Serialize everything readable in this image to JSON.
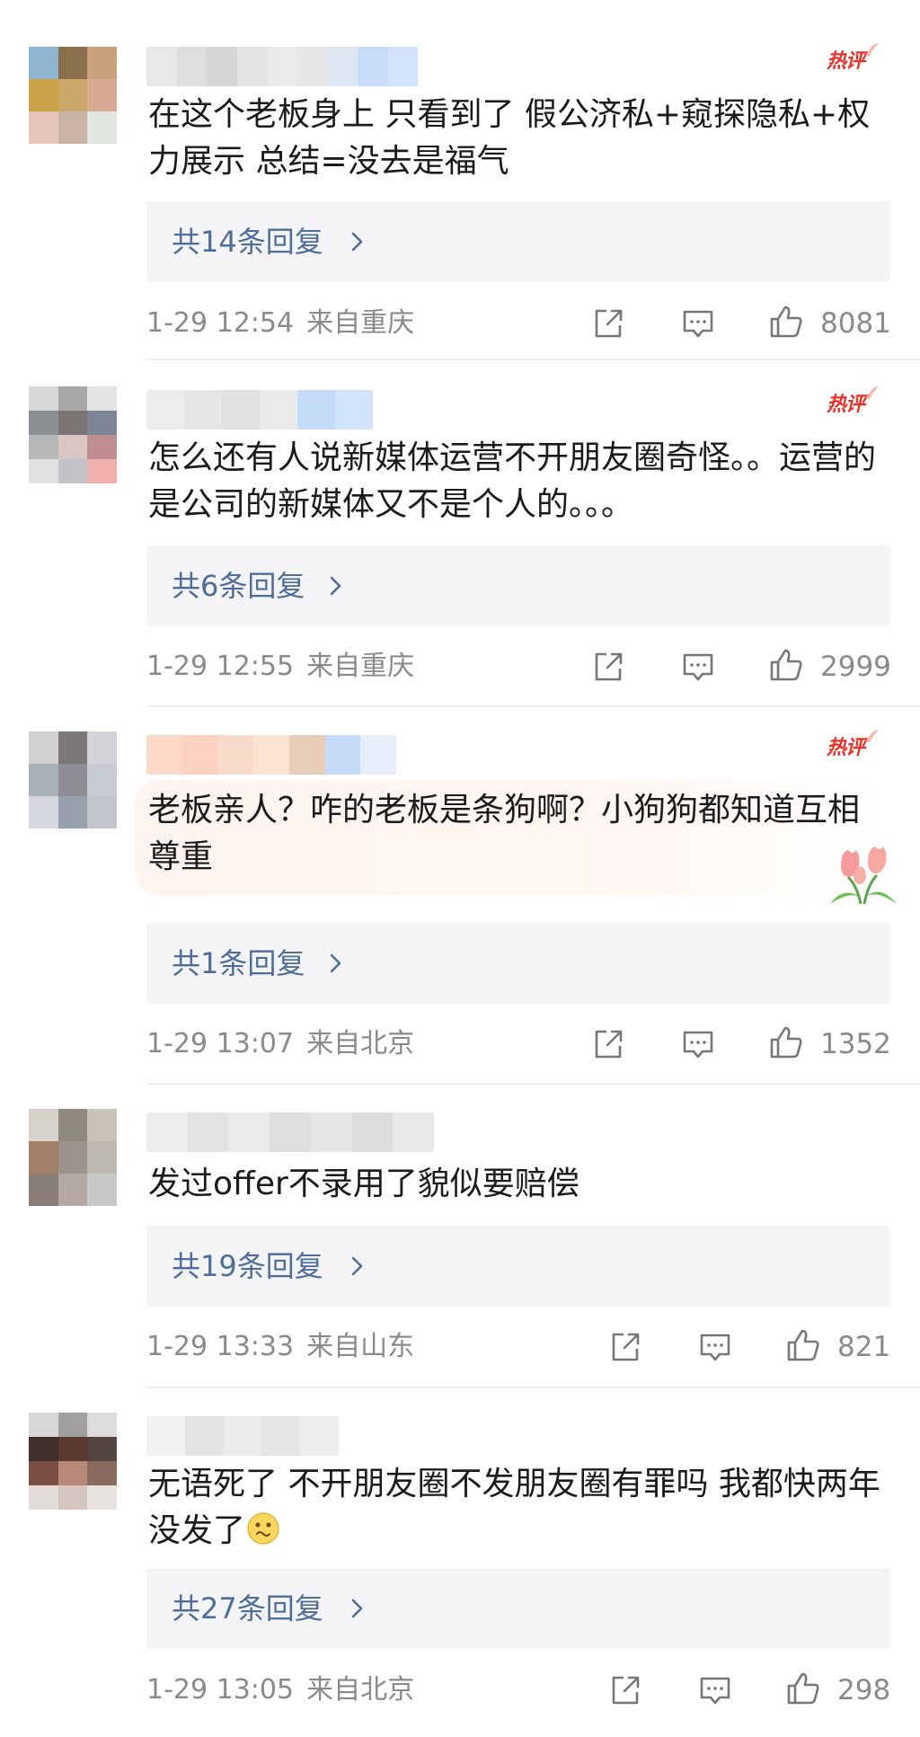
{
  "hot_badge_label": "热评",
  "colors": {
    "accent_link": "#4d6d9a",
    "hot_red": "#e6332a",
    "meta_gray": "#8a8a8a",
    "reply_bg": "#f4f4f6"
  },
  "icons": {
    "share": "share-icon",
    "comment": "comment-icon",
    "like": "thumbs-up-icon",
    "chevron": "chevron-right-icon"
  },
  "comments": [
    {
      "hot": true,
      "text": "在这个老板身上 只看到了 假公济私+窥探隐私+权力展示 总结=没去是福气",
      "reply_label": "共14条回复",
      "time": "1-29 12:54",
      "location": "来自重庆",
      "likes": "8081",
      "avatar_colors": [
        "#8fb4cf",
        "#8a6f4d",
        "#c7a27a",
        "#c9a24a",
        "#c9a86a",
        "#d8aa93",
        "#e8c6bb",
        "#c9b2a6",
        "#e0e6e0"
      ],
      "name_colors": [
        "#e8e8e8",
        "#dedede",
        "#d6d6d6",
        "#e4e4e4",
        "#eaeaea",
        "#e6e6e6",
        "#dfe6f1",
        "#c6dcf7",
        "#d0e3fa"
      ]
    },
    {
      "hot": true,
      "text": "怎么还有人说新媒体运营不开朋友圈奇怪。。运营的是公司的新媒体又不是个人的。。。",
      "reply_label": "共6条回复",
      "time": "1-29 12:55",
      "location": "来自重庆",
      "likes": "2999",
      "avatar_colors": [
        "#d7d7d7",
        "#a8a8a8",
        "#e3e3e3",
        "#8a9093",
        "#7b7674",
        "#7b8594",
        "#b6b8b6",
        "#d9c6c0",
        "#bf8c90",
        "#e2e2e2",
        "#c2c3c6",
        "#f0b0ab"
      ],
      "name_colors": [
        "#ececec",
        "#e6e6e6",
        "#e0e0e0",
        "#eaeaea",
        "#c5dcf8",
        "#d2e4fb"
      ]
    },
    {
      "hot": true,
      "text": "老板亲人？咋的老板是条狗啊？小狗狗都知道互相尊重",
      "reply_label": "共1条回复",
      "time": "1-29 13:07",
      "location": "来自北京",
      "likes": "1352",
      "avatar_colors": [
        "#d0d0d2",
        "#7c7878",
        "#d4d4d8",
        "#aab0b8",
        "#8e8e94",
        "#c7cbd3",
        "#d4d8de",
        "#9aa0ab",
        "#c0c4cc"
      ],
      "name_colors": [
        "#fbd9c6",
        "#fad2bf",
        "#f9dbc9",
        "#fbe3d2",
        "#e7cdb7",
        "#c6dbf7",
        "#e6eefa"
      ]
    },
    {
      "hot": false,
      "text": "发过offer不录用了貌似要赔偿",
      "reply_label": "共19条回复",
      "time": "1-29 13:33",
      "location": "来自山东",
      "likes": "821",
      "avatar_colors": [
        "#d6d2cc",
        "#8d8a7c",
        "#c9c2b6",
        "#a07f66",
        "#9b948c",
        "#bdb8b0",
        "#8a7f76",
        "#b3a9a2",
        "#c8c8c6"
      ],
      "name_colors": [
        "#ececec",
        "#e3e3e3",
        "#eaeaea",
        "#dedede",
        "#e6e6e6",
        "#dcdcdc",
        "#e8e8e8"
      ]
    },
    {
      "hot": false,
      "text": "无语死了 不开朋友圈不发朋友圈有罪吗 我都快两年没发了",
      "reply_label": "共27条回复",
      "time": "1-29 13:05",
      "location": "来自北京",
      "likes": "298",
      "avatar_colors": [
        "#d7d7d7",
        "#a0a0a0",
        "#dcdcdc",
        "#3e2f2a",
        "#5a3a30",
        "#54463f",
        "#7a4e42",
        "#b98a7a",
        "#8a6a60",
        "#e2dcd8",
        "#d6c6c0",
        "#e6e2df"
      ],
      "name_colors": [
        "#f1f1f1",
        "#e4e4e4",
        "#ebebeb",
        "#e6e6e6",
        "#eeeeee"
      ]
    }
  ]
}
